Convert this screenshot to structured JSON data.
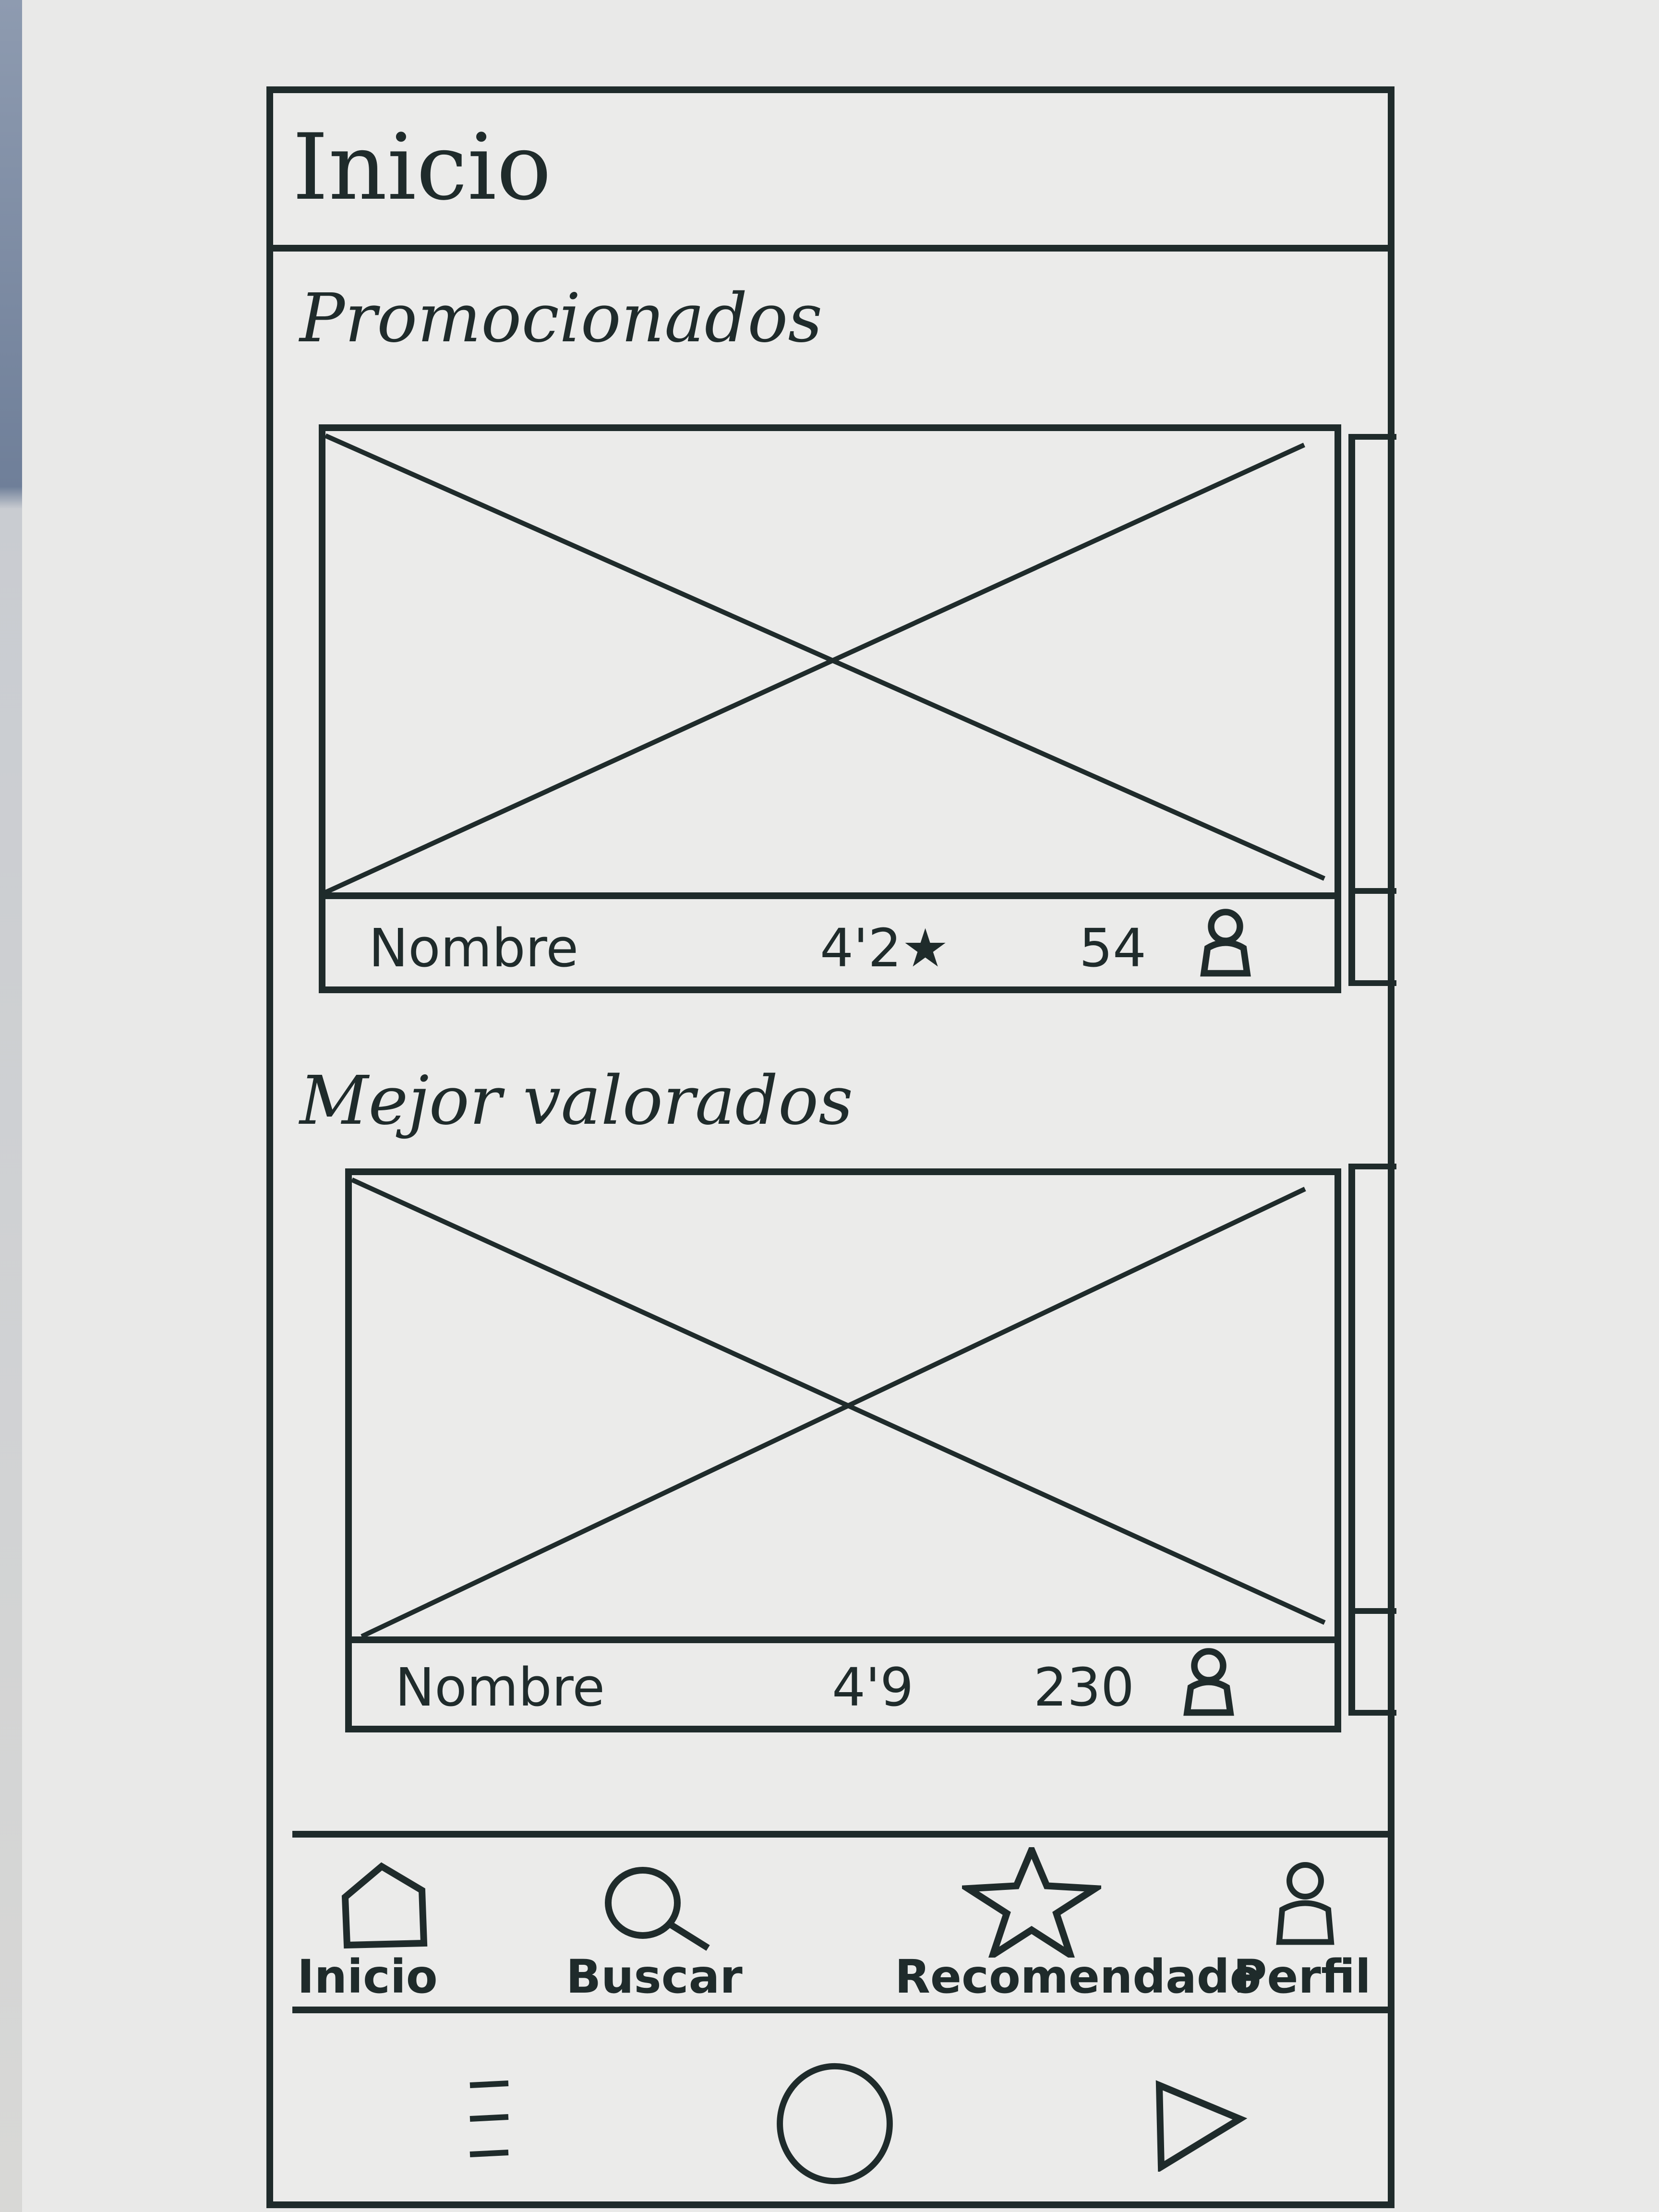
{
  "colors": {
    "ink": "#1f2b2b",
    "paper": "#ebebea"
  },
  "app_bar": {
    "title": "Inicio"
  },
  "sections": [
    {
      "title": "Promocionados",
      "card": {
        "name": "Nombre",
        "rating": "4'2",
        "rating_icon": "star-icon",
        "users": "54",
        "users_icon": "user-icon"
      }
    },
    {
      "title": "Mejor valorados",
      "card": {
        "name": "Nombre",
        "rating": "4'9",
        "users": "230",
        "users_icon": "user-icon"
      }
    }
  ],
  "bottom_nav": {
    "items": [
      {
        "label": "Inicio",
        "icon": "home-icon"
      },
      {
        "label": "Buscar",
        "icon": "search-icon"
      },
      {
        "label": "Recomendado",
        "icon": "star-icon"
      },
      {
        "label": "Perfil",
        "icon": "user-icon"
      }
    ]
  },
  "system_bar": {
    "buttons": [
      "menu-icon",
      "home-circle-icon",
      "back-triangle-icon"
    ]
  }
}
